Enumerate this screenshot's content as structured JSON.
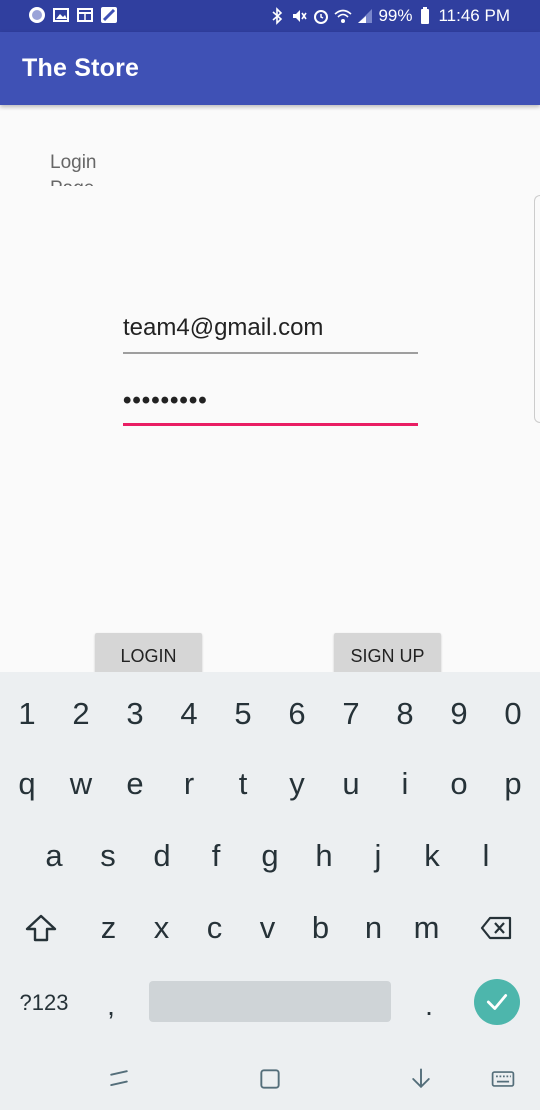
{
  "status_bar": {
    "battery": "99%",
    "time": "11:46 PM"
  },
  "app_bar": {
    "title": "The Store"
  },
  "content": {
    "page_label": "Login Page",
    "email_value": "team4@gmail.com",
    "password_value": "password1",
    "login_label": "LOGIN",
    "signup_label": "SIGN UP"
  },
  "keyboard": {
    "number_row": [
      "1",
      "2",
      "3",
      "4",
      "5",
      "6",
      "7",
      "8",
      "9",
      "0"
    ],
    "row_q": [
      "q",
      "w",
      "e",
      "r",
      "t",
      "y",
      "u",
      "i",
      "o",
      "p"
    ],
    "row_a": [
      "a",
      "s",
      "d",
      "f",
      "g",
      "h",
      "j",
      "k",
      "l"
    ],
    "row_z": [
      "z",
      "x",
      "c",
      "v",
      "b",
      "n",
      "m"
    ],
    "symbols_label": "?123",
    "comma": ",",
    "period": ".",
    "accent_color": "#4db6ac"
  },
  "colors": {
    "status_bar": "#303f9f",
    "app_bar": "#3f51b5",
    "focus_underline": "#e91e63"
  }
}
